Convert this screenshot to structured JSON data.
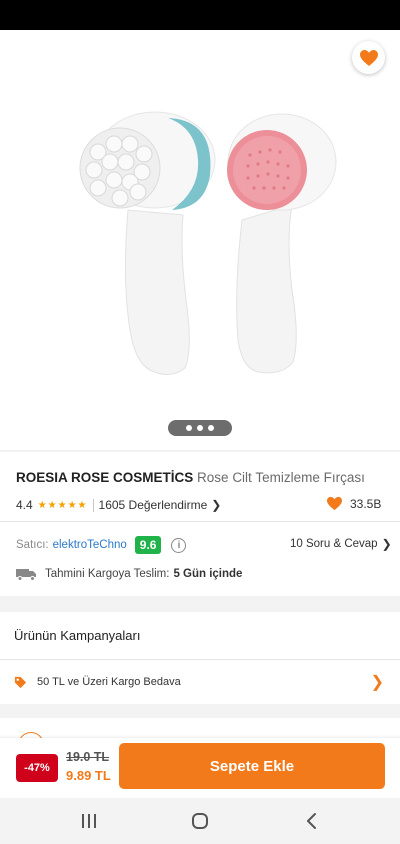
{
  "header": {
    "back_icon": "arrow-left-icon",
    "share_icon": "share-icon",
    "favorite_icon": "heart-icon",
    "accent": "#f27a1a"
  },
  "gallery": {
    "page_count": 3
  },
  "product": {
    "brand": "ROESIA ROSE COSMETİCS",
    "name": "Rose Cilt Temizleme Fırçası",
    "rating": "4.4",
    "stars_filled": 4.4,
    "stars_text": "★★★★★",
    "reviews": "1605 Değerlendirme",
    "likes": "33.5B"
  },
  "seller": {
    "label": "Satıcı:",
    "name": "elektroTeChno",
    "score": "9.6",
    "score_color": "#1fb34a",
    "qa": "10 Soru & Cevap"
  },
  "delivery": {
    "label": "Tahmini Kargoya Teslim:",
    "value": "5 Gün içinde"
  },
  "campaigns": {
    "title": "Ürünün Kampanyaları",
    "items": [
      {
        "label": "50 TL ve Üzeri Kargo Bedava",
        "icon": "tag-icon"
      }
    ]
  },
  "purchase": {
    "discount": "-47%",
    "old_price": "19.0 TL",
    "new_price": "9.89 TL",
    "cart_label": "Sepete Ekle"
  },
  "system_nav": {
    "recents_icon": "recents-icon",
    "home_icon": "home-icon",
    "back_icon": "back-chevron-icon"
  }
}
